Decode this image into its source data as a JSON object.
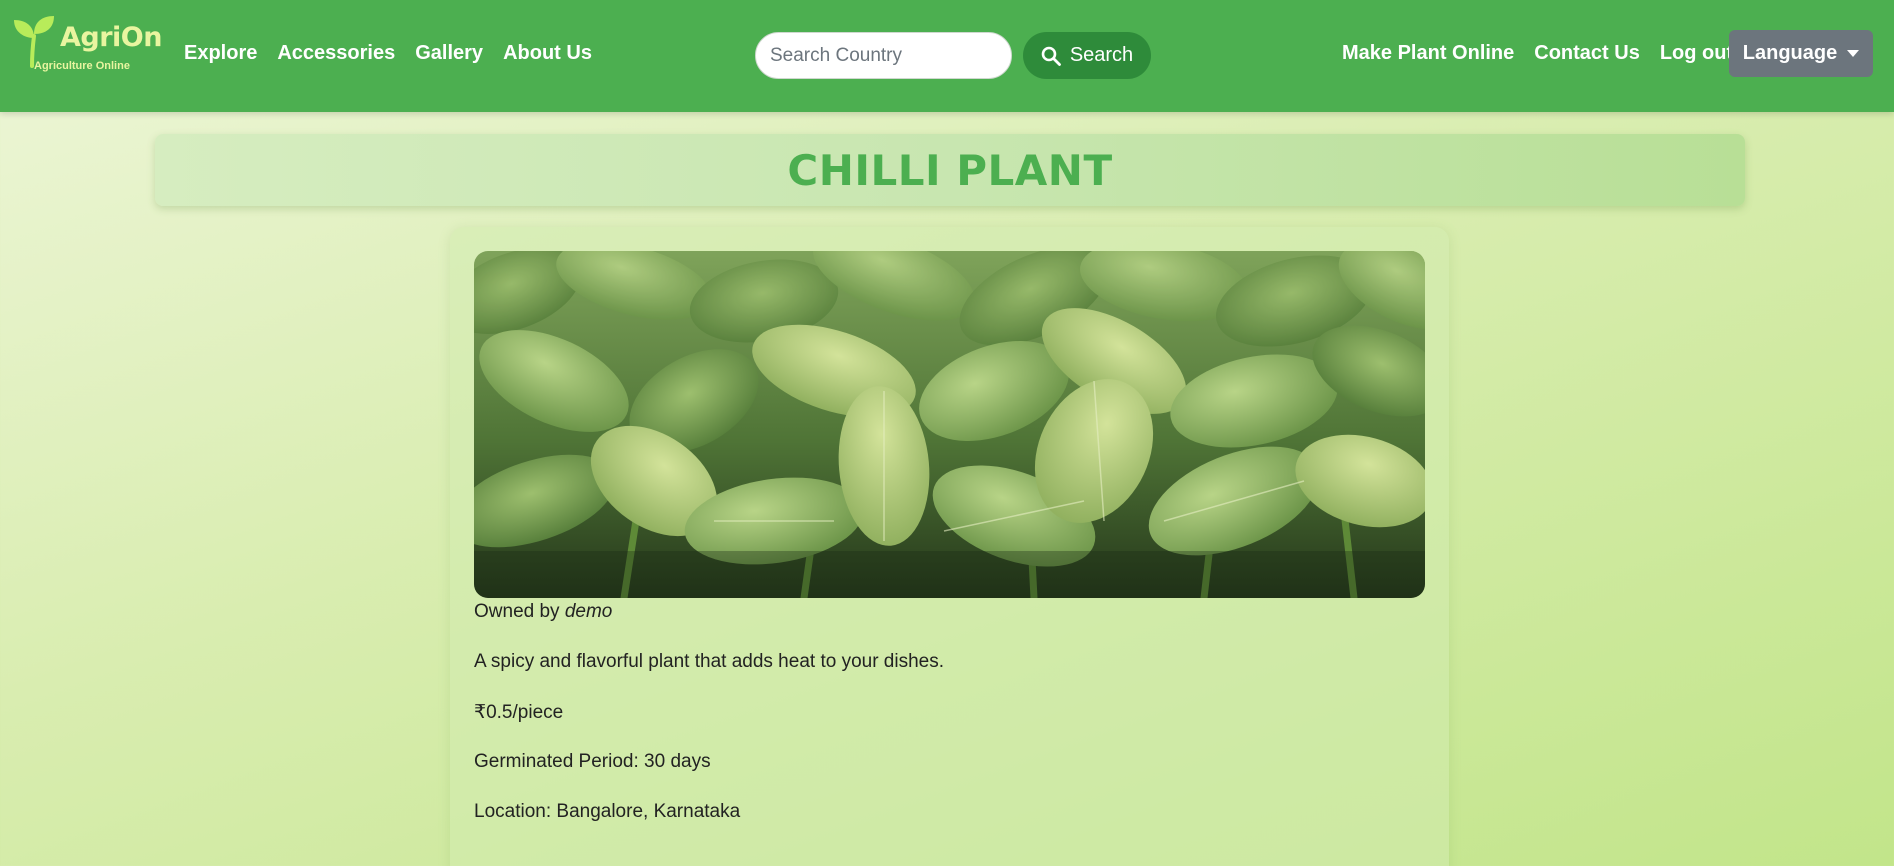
{
  "brand": {
    "name": "AgriOn",
    "tagline": "Agriculture Online"
  },
  "nav": {
    "left_items": [
      {
        "label": "Explore"
      },
      {
        "label": "Accessories"
      },
      {
        "label": "Gallery"
      },
      {
        "label": "About Us"
      }
    ],
    "search": {
      "placeholder": "Search Country",
      "value": "",
      "button_label": "Search",
      "button_icon": "search-icon"
    },
    "right_items": [
      {
        "label": "Make Plant Online"
      },
      {
        "label": "Contact Us"
      },
      {
        "label": "Log out"
      }
    ],
    "language_label": "Language"
  },
  "plant": {
    "title": "CHILLI PLANT",
    "image_alt": "Chilli plant seedlings",
    "owner_prefix": "Owned by",
    "owner": "demo",
    "description": "A spicy and flavorful plant that adds heat to your dishes.",
    "price": "₹0.5/piece",
    "germinated_period": "Germinated Period: 30 days",
    "location": "Location: Bangalore, Karnataka"
  },
  "colors": {
    "navbar": "#4caf50",
    "brand_text": "#e9f5a0",
    "search_button": "#2e8b3a",
    "language_button": "#6c757d",
    "title_text": "#4caf50"
  }
}
